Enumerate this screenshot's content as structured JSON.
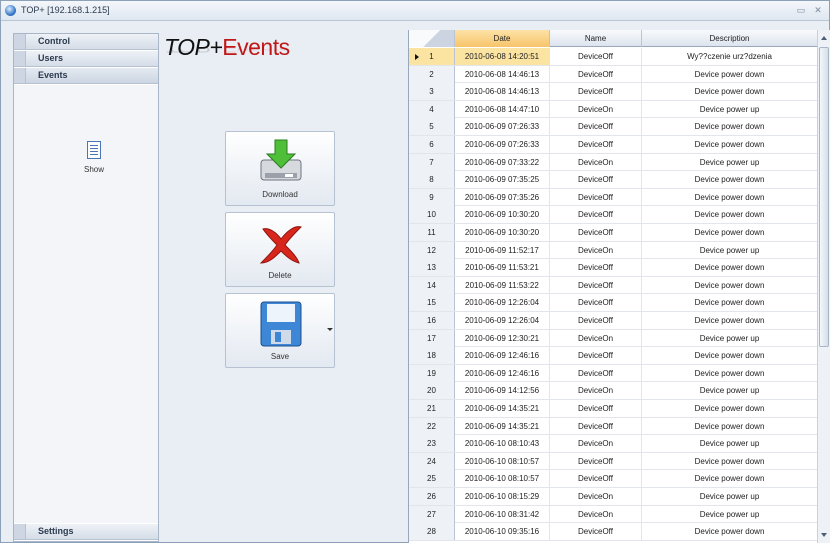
{
  "window": {
    "title": "TOP+ [192.168.1.215]",
    "min_glyph": "▭",
    "close_glyph": "✕"
  },
  "nav": {
    "sections": [
      {
        "label": "Control"
      },
      {
        "label": "Users"
      },
      {
        "label": "Events"
      }
    ],
    "events_items": [
      {
        "label": "Show",
        "icon": "table-icon"
      }
    ],
    "settings_label": "Settings"
  },
  "brand": {
    "prefix": "TOP+",
    "accent": "Events",
    "accent_color": "#c01818"
  },
  "actions": {
    "download": "Download",
    "delete": "Delete",
    "save": "Save"
  },
  "grid": {
    "columns": [
      "Date",
      "Name",
      "Description"
    ],
    "selected_row": 1,
    "rows": [
      {
        "n": "1",
        "date": "2010-06-08 14:20:51",
        "name": "DeviceOff",
        "desc": "Wy??czenie urz?dzenia"
      },
      {
        "n": "2",
        "date": "2010-06-08 14:46:13",
        "name": "DeviceOff",
        "desc": "Device power down"
      },
      {
        "n": "3",
        "date": "2010-06-08 14:46:13",
        "name": "DeviceOff",
        "desc": "Device power down"
      },
      {
        "n": "4",
        "date": "2010-06-08 14:47:10",
        "name": "DeviceOn",
        "desc": "Device power up"
      },
      {
        "n": "5",
        "date": "2010-06-09 07:26:33",
        "name": "DeviceOff",
        "desc": "Device power down"
      },
      {
        "n": "6",
        "date": "2010-06-09 07:26:33",
        "name": "DeviceOff",
        "desc": "Device power down"
      },
      {
        "n": "7",
        "date": "2010-06-09 07:33:22",
        "name": "DeviceOn",
        "desc": "Device power up"
      },
      {
        "n": "8",
        "date": "2010-06-09 07:35:25",
        "name": "DeviceOff",
        "desc": "Device power down"
      },
      {
        "n": "9",
        "date": "2010-06-09 07:35:26",
        "name": "DeviceOff",
        "desc": "Device power down"
      },
      {
        "n": "10",
        "date": "2010-06-09 10:30:20",
        "name": "DeviceOff",
        "desc": "Device power down"
      },
      {
        "n": "11",
        "date": "2010-06-09 10:30:20",
        "name": "DeviceOff",
        "desc": "Device power down"
      },
      {
        "n": "12",
        "date": "2010-06-09 11:52:17",
        "name": "DeviceOn",
        "desc": "Device power up"
      },
      {
        "n": "13",
        "date": "2010-06-09 11:53:21",
        "name": "DeviceOff",
        "desc": "Device power down"
      },
      {
        "n": "14",
        "date": "2010-06-09 11:53:22",
        "name": "DeviceOff",
        "desc": "Device power down"
      },
      {
        "n": "15",
        "date": "2010-06-09 12:26:04",
        "name": "DeviceOff",
        "desc": "Device power down"
      },
      {
        "n": "16",
        "date": "2010-06-09 12:26:04",
        "name": "DeviceOff",
        "desc": "Device power down"
      },
      {
        "n": "17",
        "date": "2010-06-09 12:30:21",
        "name": "DeviceOn",
        "desc": "Device power up"
      },
      {
        "n": "18",
        "date": "2010-06-09 12:46:16",
        "name": "DeviceOff",
        "desc": "Device power down"
      },
      {
        "n": "19",
        "date": "2010-06-09 12:46:16",
        "name": "DeviceOff",
        "desc": "Device power down"
      },
      {
        "n": "20",
        "date": "2010-06-09 14:12:56",
        "name": "DeviceOn",
        "desc": "Device power up"
      },
      {
        "n": "21",
        "date": "2010-06-09 14:35:21",
        "name": "DeviceOff",
        "desc": "Device power down"
      },
      {
        "n": "22",
        "date": "2010-06-09 14:35:21",
        "name": "DeviceOff",
        "desc": "Device power down"
      },
      {
        "n": "23",
        "date": "2010-06-10 08:10:43",
        "name": "DeviceOn",
        "desc": "Device power up"
      },
      {
        "n": "24",
        "date": "2010-06-10 08:10:57",
        "name": "DeviceOff",
        "desc": "Device power down"
      },
      {
        "n": "25",
        "date": "2010-06-10 08:10:57",
        "name": "DeviceOff",
        "desc": "Device power down"
      },
      {
        "n": "26",
        "date": "2010-06-10 08:15:29",
        "name": "DeviceOn",
        "desc": "Device power up"
      },
      {
        "n": "27",
        "date": "2010-06-10 08:31:42",
        "name": "DeviceOn",
        "desc": "Device power up"
      },
      {
        "n": "28",
        "date": "2010-06-10 09:35:16",
        "name": "DeviceOff",
        "desc": "Device power down"
      }
    ]
  }
}
